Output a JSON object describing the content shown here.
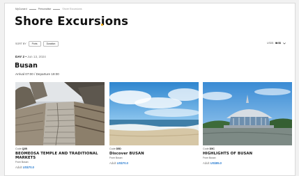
{
  "breadcrumb": [
    "MyCunard",
    "Personalise",
    "Shore Excursions"
  ],
  "page_title": "Shore Excursions",
  "sort": {
    "label": "SORT BY",
    "options": [
      "Ports",
      "Duration"
    ]
  },
  "currency": {
    "label": "USD$",
    "value": "₩ $$"
  },
  "day": {
    "label": "DAY 2",
    "date": "Jun 13, 2024"
  },
  "port": {
    "name": "Busan",
    "times": "Arrival 07:00 / Departure 19:00"
  },
  "excursions": [
    {
      "code_label": "Code",
      "code": "Q2B",
      "title": "BEOMEOSA TEMPLE AND TRADITIONAL MARKETS",
      "from": "From Busan",
      "price_label": "Adult",
      "price": "US$70.0"
    },
    {
      "code_label": "Code",
      "code": "D5D",
      "title": "Discover BUSAN",
      "from": "From Busan",
      "price_label": "Adult",
      "price": "US$70.0"
    },
    {
      "code_label": "Code",
      "code": "D5C",
      "title": "HIGHLIGHTS OF BUSAN",
      "from": "From Busan",
      "price_label": "Adult",
      "price": "US$85.0"
    }
  ],
  "colors": {
    "accent_dot": "#f2a900",
    "price": "#2e7fd1",
    "background": "#f1f1f1"
  }
}
